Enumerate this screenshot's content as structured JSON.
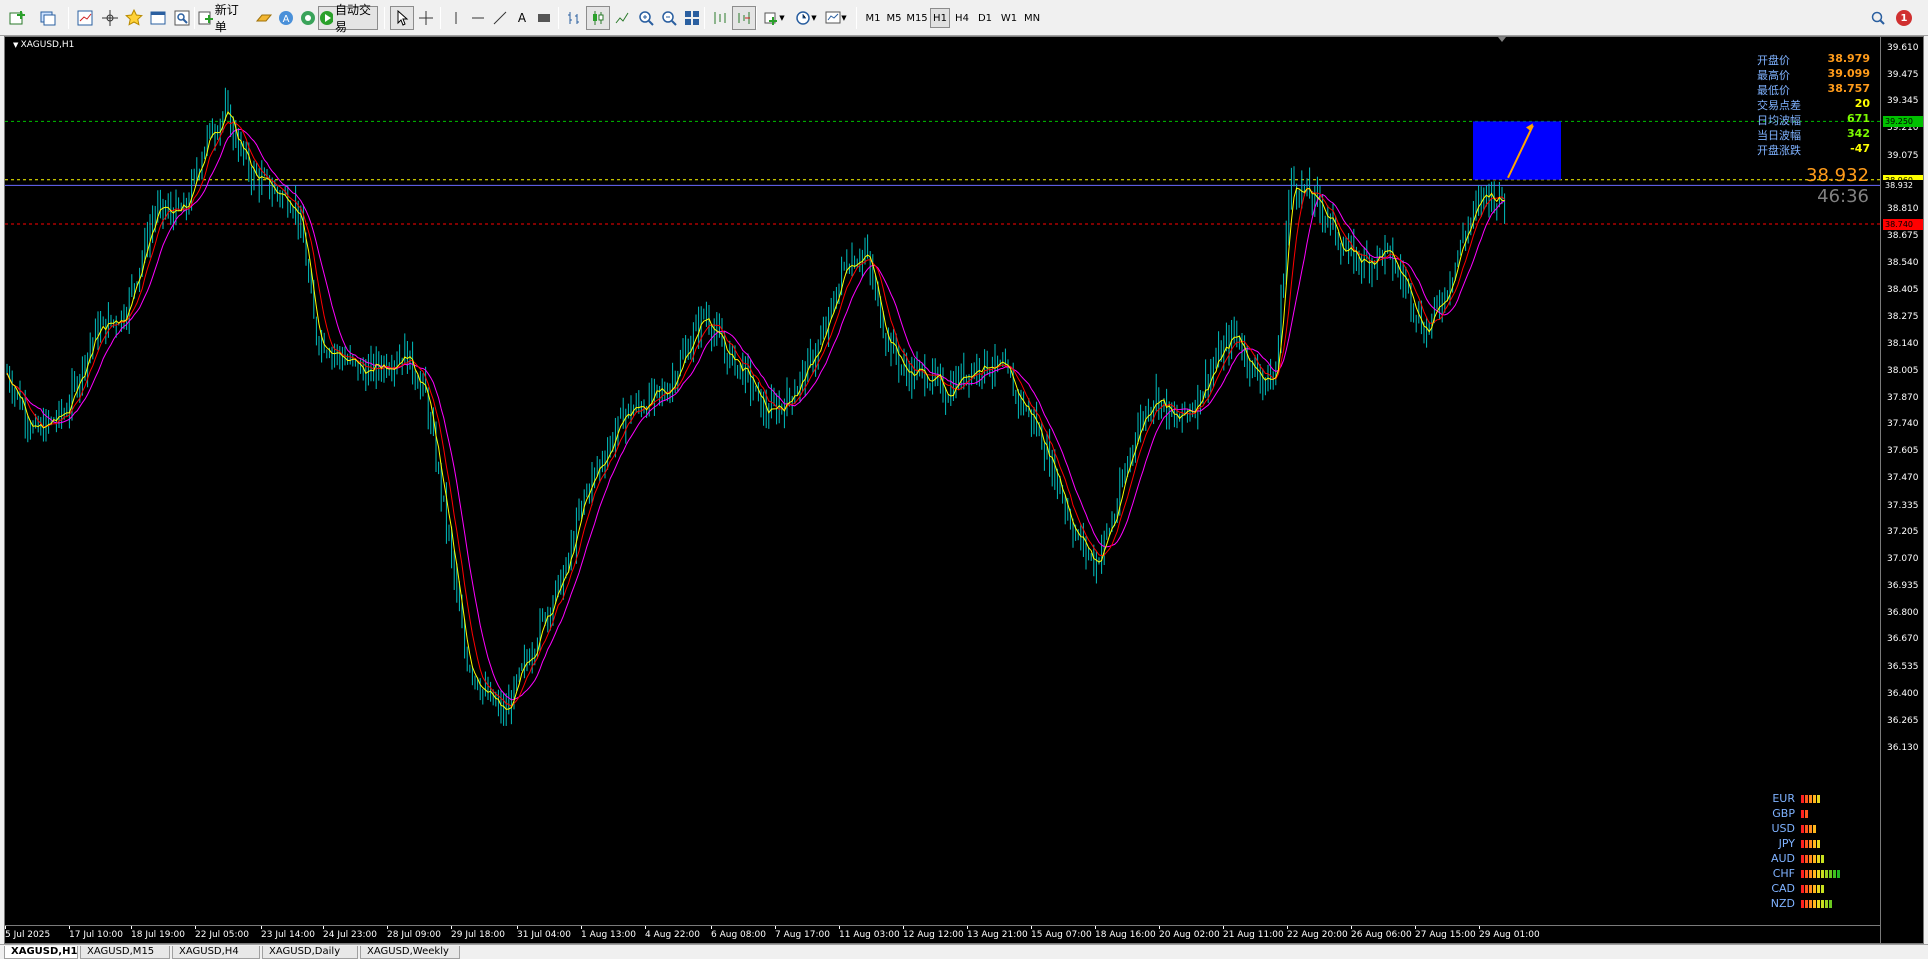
{
  "toolbar": {
    "new_order_label": "新订单",
    "auto_trading_label": "自动交易",
    "timeframes": [
      "M1",
      "M5",
      "M15",
      "H1",
      "H4",
      "D1",
      "W1",
      "MN"
    ],
    "active_timeframe": "H1",
    "notification_count": "1"
  },
  "chart": {
    "symbol_label": "XAGUSD,H1",
    "price_scale": [
      "39.610",
      "39.475",
      "39.345",
      "39.210",
      "39.075",
      "38.932",
      "38.810",
      "38.675",
      "38.540",
      "38.405",
      "38.275",
      "38.140",
      "38.005",
      "37.870",
      "37.740",
      "37.605",
      "37.470",
      "37.335",
      "37.205",
      "37.070",
      "36.935",
      "36.800",
      "36.670",
      "36.535",
      "36.400",
      "36.265",
      "36.130"
    ],
    "price_tags": {
      "green_line": "39.250",
      "yellow_line": "38.960",
      "current": "38.932",
      "red_line": "38.740"
    },
    "time_labels": [
      "5 Jul 2025",
      "17 Jul 10:00",
      "18 Jul 19:00",
      "22 Jul 05:00",
      "23 Jul 14:00",
      "24 Jul 23:00",
      "28 Jul 09:00",
      "29 Jul 18:00",
      "31 Jul 04:00",
      "1 Aug 13:00",
      "4 Aug 22:00",
      "6 Aug 08:00",
      "7 Aug 17:00",
      "11 Aug 03:00",
      "12 Aug 12:00",
      "13 Aug 21:00",
      "15 Aug 07:00",
      "18 Aug 16:00",
      "20 Aug 02:00",
      "21 Aug 11:00",
      "22 Aug 20:00",
      "26 Aug 06:00",
      "27 Aug 15:00",
      "29 Aug 01:00"
    ],
    "colors": {
      "background": "#000000",
      "bull": "#00c0c0",
      "bear": "#00c0c0",
      "ma_fast": "#ffff00",
      "ma_mid": "#ff0000",
      "ma_slow": "#ff00ff",
      "highlight_box": "#0000ff",
      "arrow": "#ffa500"
    }
  },
  "info_panel": {
    "rows": [
      {
        "label": "开盘价",
        "value": "38.979",
        "color": "#ff9b1a"
      },
      {
        "label": "最高价",
        "value": "39.099",
        "color": "#ff9b1a"
      },
      {
        "label": "最低价",
        "value": "38.757",
        "color": "#ff9b1a"
      },
      {
        "label": "交易点差",
        "value": "20",
        "color": "#ffff00"
      },
      {
        "label": "日均波幅",
        "value": "671",
        "color": "#7cfc00"
      },
      {
        "label": "当日波幅",
        "value": "342",
        "color": "#7cfc00"
      },
      {
        "label": "开盘涨跌",
        "value": "-47",
        "color": "#ffff00"
      }
    ],
    "big_price": "38.932",
    "timer": "46:36"
  },
  "currency_strength": [
    {
      "code": "EUR",
      "level": 5
    },
    {
      "code": "GBP",
      "level": 2
    },
    {
      "code": "USD",
      "level": 4
    },
    {
      "code": "JPY",
      "level": 5
    },
    {
      "code": "AUD",
      "level": 6
    },
    {
      "code": "CHF",
      "level": 10
    },
    {
      "code": "CAD",
      "level": 6
    },
    {
      "code": "NZD",
      "level": 8
    }
  ],
  "tabs": [
    "XAGUSD,H1",
    "XAGUSD,M15",
    "XAGUSD,H4",
    "XAGUSD,Daily",
    "XAGUSD,Weekly"
  ],
  "active_tab": "XAGUSD,H1"
}
